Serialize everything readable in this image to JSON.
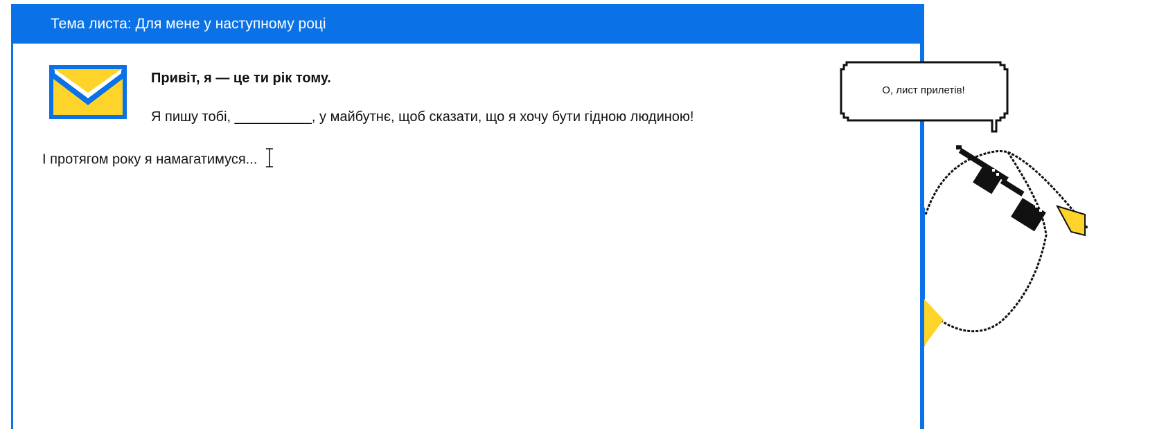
{
  "letter": {
    "subject": "Тема листа: Для мене у наступному році",
    "greeting": "Привіт, я — це ти рік тому.",
    "intro": "Я пишу тобі, __________, у майбутнє, щоб сказати, що я хочу бути гідною людиною!",
    "body": "І протягом року я намагатимуся..."
  },
  "mascot": {
    "speech": "О, лист прилетів!"
  },
  "icons": {
    "envelope": "envelope-icon",
    "cursor": "text-cursor-icon"
  },
  "colors": {
    "accent": "#0a72e6",
    "envelope_yellow": "#ffd42a"
  }
}
